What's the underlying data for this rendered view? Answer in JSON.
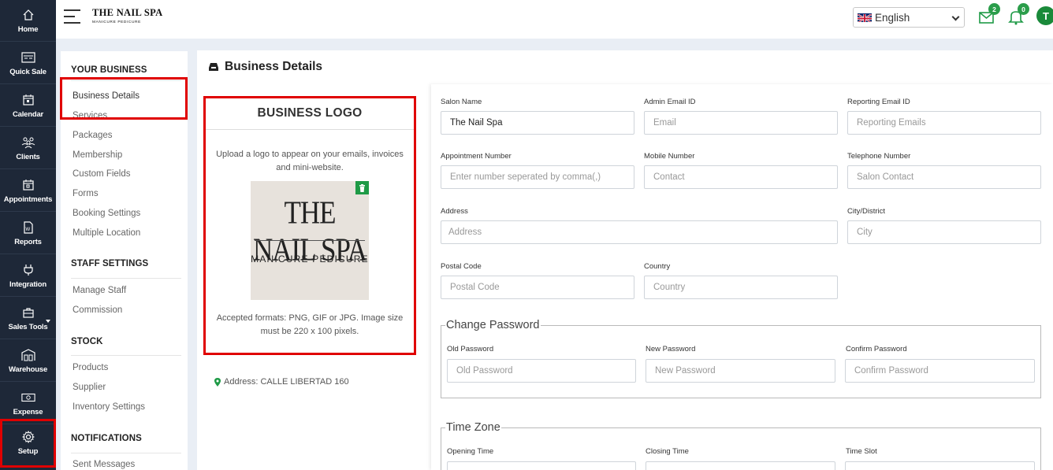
{
  "rail": [
    {
      "label": "Home",
      "icon": "home-icon"
    },
    {
      "label": "Quick Sale",
      "icon": "register-icon"
    },
    {
      "label": "Calendar",
      "icon": "calendar-icon"
    },
    {
      "label": "Clients",
      "icon": "users-icon"
    },
    {
      "label": "Appointments",
      "icon": "calendar-check-icon"
    },
    {
      "label": "Reports",
      "icon": "report-icon"
    },
    {
      "label": "Integration",
      "icon": "plug-icon"
    },
    {
      "label": "Sales Tools",
      "icon": "briefcase-icon"
    },
    {
      "label": "Warehouse",
      "icon": "warehouse-icon"
    },
    {
      "label": "Expense",
      "icon": "money-icon"
    },
    {
      "label": "Setup",
      "icon": "gear-icon"
    }
  ],
  "brand": {
    "title": "THE NAIL SPA",
    "subtitle": "MANICURE PEDICURE"
  },
  "language": {
    "selected": "English"
  },
  "notifications": {
    "messages_count": "2",
    "alerts_count": "0"
  },
  "user": {
    "initial": "T"
  },
  "side_menu": {
    "your_business": {
      "heading": "YOUR BUSINESS",
      "items": [
        "Business Details",
        "Services",
        "Packages",
        "Membership",
        "Custom Fields",
        "Forms",
        "Booking Settings",
        "Multiple Location"
      ]
    },
    "staff_settings": {
      "heading": "STAFF SETTINGS",
      "items": [
        "Manage Staff",
        "Commission"
      ]
    },
    "stock": {
      "heading": "STOCK",
      "items": [
        "Products",
        "Supplier",
        "Inventory Settings"
      ]
    },
    "notifications": {
      "heading": "NOTIFICATIONS",
      "items": [
        "Sent Messages"
      ]
    }
  },
  "main": {
    "title": "Business Details",
    "logo": {
      "heading": "BUSINESS LOGO",
      "upload_text": "Upload a logo to appear on your emails, invoices and mini-website.",
      "image_line1": "THE NAIL SPA",
      "image_line2": "MANICURE PEDICURE",
      "accepted_text": "Accepted formats: PNG, GIF or JPG. Image size must be 220 x 100 pixels."
    },
    "address_line": "Address: CALLE LIBERTAD 160"
  },
  "form": {
    "salon_name": {
      "label": "Salon Name",
      "value": "The Nail Spa"
    },
    "admin_email": {
      "label": "Admin Email ID",
      "placeholder": "Email"
    },
    "reporting_email": {
      "label": "Reporting Email ID",
      "placeholder": "Reporting Emails"
    },
    "appointment_number": {
      "label": "Appointment Number",
      "placeholder": "Enter number seperated by comma(,)"
    },
    "mobile_number": {
      "label": "Mobile Number",
      "placeholder": "Contact"
    },
    "telephone_number": {
      "label": "Telephone Number",
      "placeholder": "Salon Contact"
    },
    "address": {
      "label": "Address",
      "placeholder": "Address"
    },
    "city": {
      "label": "City/District",
      "placeholder": "City"
    },
    "postal_code": {
      "label": "Postal Code",
      "placeholder": "Postal Code"
    },
    "country": {
      "label": "Country",
      "placeholder": "Country"
    },
    "change_password": {
      "legend": "Change Password",
      "old": {
        "label": "Old Password",
        "placeholder": "Old Password"
      },
      "new": {
        "label": "New Password",
        "placeholder": "New Password"
      },
      "confirm": {
        "label": "Confirm Password",
        "placeholder": "Confirm Password"
      }
    },
    "time_zone": {
      "legend": "Time Zone",
      "opening_label": "Opening Time",
      "closing_label": "Closing Time",
      "slot_label": "Time Slot"
    }
  },
  "colors": {
    "rail_bg": "#1e2838",
    "highlight": "#e00000",
    "accent_green": "#1e9a46"
  }
}
